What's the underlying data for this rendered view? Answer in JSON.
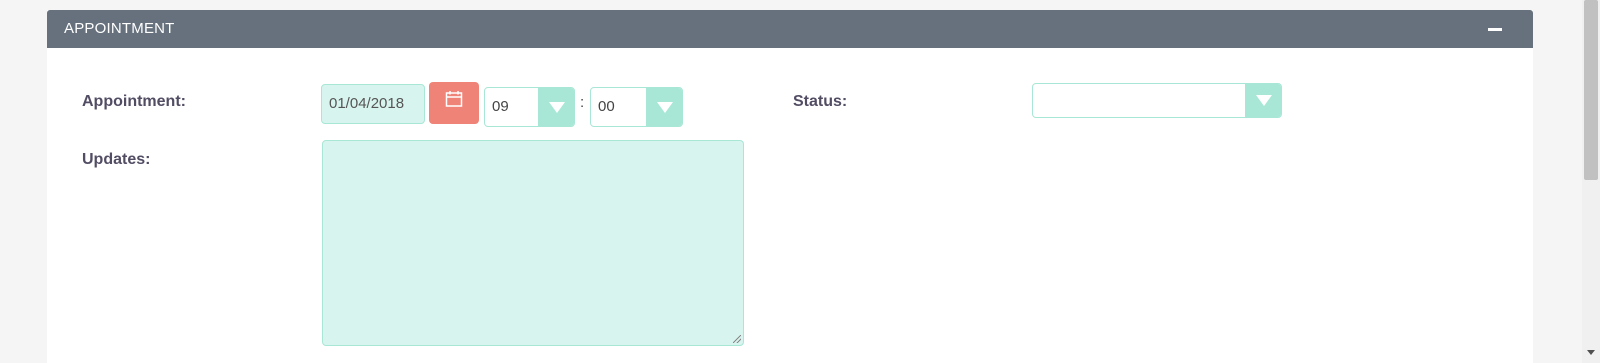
{
  "panel": {
    "title": "APPOINTMENT",
    "collapse_icon": "minus-icon"
  },
  "form": {
    "appointment_label": "Appointment:",
    "date_value": "01/04/2018",
    "calendar_icon": "calendar-icon",
    "hour_value": "09",
    "time_separator": ":",
    "minute_value": "00",
    "status_label": "Status:",
    "status_value": "",
    "updates_label": "Updates:",
    "updates_value": ""
  },
  "colors": {
    "header_bg": "#66717d",
    "field_bg": "#d8f4ee",
    "field_border": "#a8e7d6",
    "calendar_button": "#f08377",
    "label_text": "#534d64"
  }
}
